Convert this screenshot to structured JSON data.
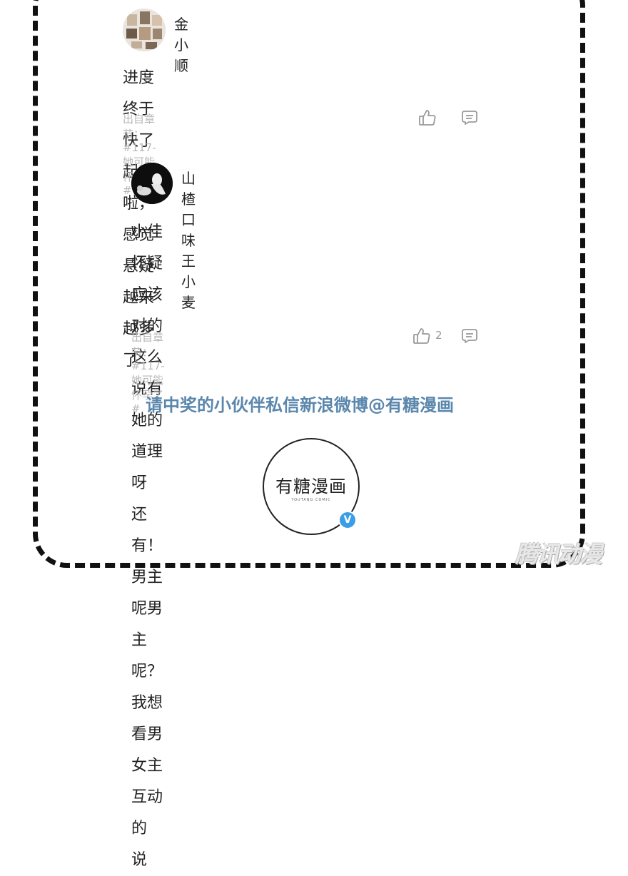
{
  "comments": [
    {
      "username": "金小顺",
      "lines": [
        "进度终于快了起来啦，感觉悬疑越来越多了"
      ],
      "chapter": "出自章节：#117-她可能怀孕了#",
      "like_count": ""
    },
    {
      "username": "山楂口味王小麦",
      "lines": [
        "小佳怀疑应该对的这么说有她的道理呀",
        "还有！男主呢男主呢？我想看男女主互动的",
        "说"
      ],
      "chapter": "出自章节：#117-她可能怀孕了#",
      "like_count": "2"
    }
  ],
  "notice": "请中奖的小伙伴私信新浪微博@有糖漫画",
  "logo": {
    "name": "有糖漫画",
    "sub": "YOUTANG COMIC",
    "badge": "V"
  },
  "watermark": "腾讯动漫",
  "icons": {
    "like": "thumbs-up-icon",
    "reply": "comment-bubble-icon"
  },
  "colors": {
    "notice": "#5b87ad",
    "verified": "#3a9ee6"
  }
}
